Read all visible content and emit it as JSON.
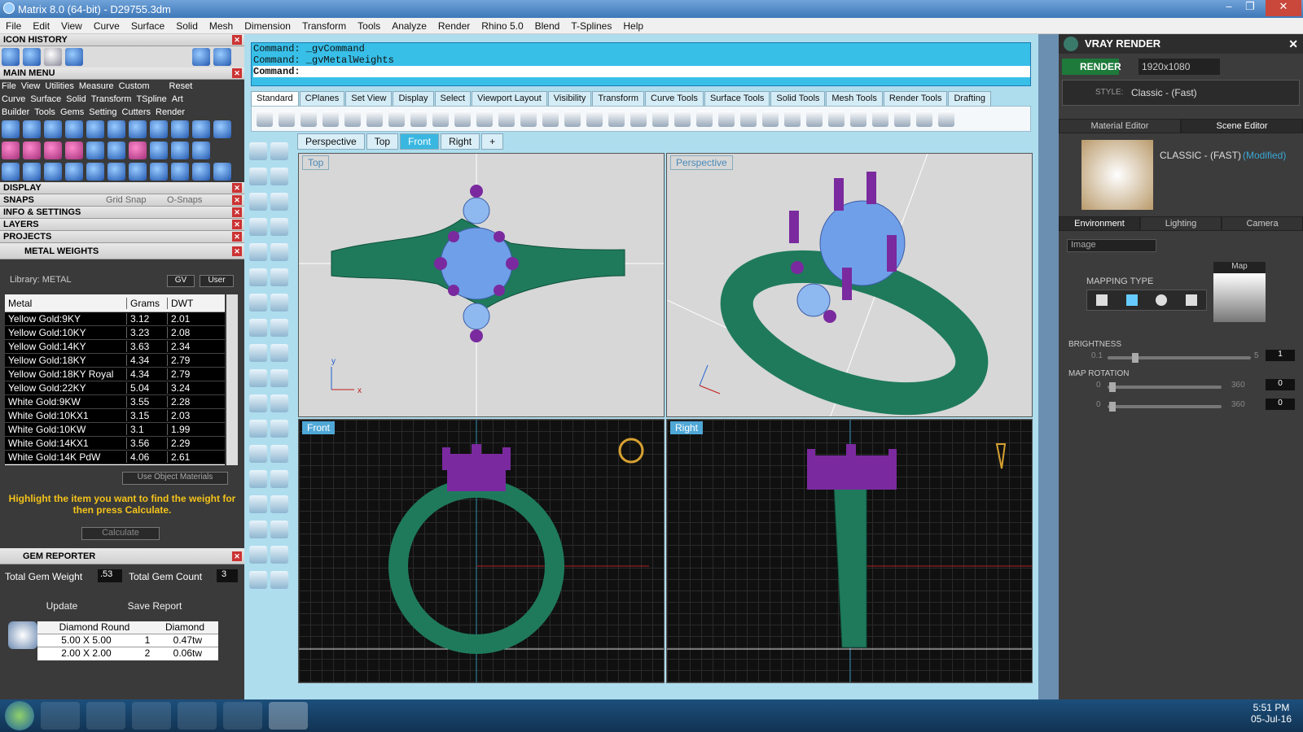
{
  "window": {
    "title": "Matrix 8.0 (64-bit) - D29755.3dm",
    "min": "–",
    "max": "❐",
    "close": "✕"
  },
  "menu": [
    "File",
    "Edit",
    "View",
    "Curve",
    "Surface",
    "Solid",
    "Mesh",
    "Dimension",
    "Transform",
    "Tools",
    "Analyze",
    "Render",
    "Rhino 5.0",
    "Blend",
    "T-Splines",
    "Help"
  ],
  "left": {
    "icon_history": "ICON HISTORY",
    "main_menu": "MAIN MENU",
    "main_sub": [
      "File",
      "View",
      "Utilities",
      "Measure",
      "Custom",
      "Reset"
    ],
    "tools_row1": [
      "Curve",
      "Surface",
      "Solid",
      "Transform",
      "TSpline",
      "Art"
    ],
    "tools_row2": [
      "Builder",
      "Tools",
      "Gems",
      "Setting",
      "Cutters",
      "Render"
    ],
    "display": "DISPLAY",
    "snaps": "SNAPS",
    "grid_snap": "Grid Snap",
    "o_snaps": "O-Snaps",
    "info": "INFO & SETTINGS",
    "layers": "LAYERS",
    "projects": "PROJECTS",
    "metal_weights": "METAL WEIGHTS",
    "library": "Library: METAL",
    "gv": "GV",
    "user": "User",
    "table_header": {
      "metal": "Metal",
      "grams": "Grams",
      "dwt": "DWT"
    },
    "metals": [
      [
        "Yellow Gold:9KY",
        "3.12",
        "2.01"
      ],
      [
        "Yellow Gold:10KY",
        "3.23",
        "2.08"
      ],
      [
        "Yellow Gold:14KY",
        "3.63",
        "2.34"
      ],
      [
        "Yellow Gold:18KY",
        "4.34",
        "2.79"
      ],
      [
        "Yellow Gold:18KY Royal",
        "4.34",
        "2.79"
      ],
      [
        "Yellow Gold:22KY",
        "5.04",
        "3.24"
      ],
      [
        "White Gold:9KW",
        "3.55",
        "2.28"
      ],
      [
        "White Gold:10KX1",
        "3.15",
        "2.03"
      ],
      [
        "White Gold:10KW",
        "3.1",
        "1.99"
      ],
      [
        "White Gold:14KX1",
        "3.56",
        "2.29"
      ],
      [
        "White Gold:14K PdW",
        "4.06",
        "2.61"
      ]
    ],
    "use_obj": "Use Object Materials",
    "hint": "Highlight the item you want to find the weight for then press Calculate.",
    "calculate": "Calculate",
    "gem_reporter": "GEM REPORTER",
    "total_gem_weight_label": "Total Gem Weight",
    "total_gem_weight": ".53",
    "total_gem_count_label": "Total Gem Count",
    "total_gem_count": "3",
    "update": "Update",
    "save_report": "Save Report",
    "gem_header": [
      "Diamond Round",
      "Diamond"
    ],
    "gems": [
      [
        "5.00 X 5.00",
        "1",
        "0.47tw"
      ],
      [
        "2.00 X 2.00",
        "2",
        "0.06tw"
      ]
    ]
  },
  "center": {
    "cmd1": "Command: _gvCommand",
    "cmd2": "Command: _gvMetalWeights",
    "cmd3": "Command:",
    "tabs": [
      "Standard",
      "CPlanes",
      "Set View",
      "Display",
      "Select",
      "Viewport Layout",
      "Visibility",
      "Transform",
      "Curve Tools",
      "Surface Tools",
      "Solid Tools",
      "Mesh Tools",
      "Render Tools",
      "Drafting"
    ],
    "view_tabs": [
      "Perspective",
      "Top",
      "Front",
      "Right"
    ],
    "vp_top": "Top",
    "vp_persp": "Perspective",
    "vp_front": "Front",
    "vp_right": "Right"
  },
  "right": {
    "title": "VRAY RENDER",
    "render": "RENDER",
    "resolution": "1920x1080",
    "style_label": "STYLE:",
    "style": "Classic - (Fast)",
    "mat_editor": "Material Editor",
    "scene_editor": "Scene Editor",
    "preset": "CLASSIC - (FAST)",
    "modified": "(Modified)",
    "env_tabs": [
      "Environment",
      "Lighting",
      "Camera"
    ],
    "image": "Image",
    "map": "Map",
    "mapping_type": "MAPPING TYPE",
    "brightness": "BRIGHTNESS",
    "b_min": "0.1",
    "b_max": "5",
    "b_val": "1",
    "map_rotation": "MAP ROTATION",
    "r1_min": "0",
    "r1_max": "360",
    "r1_val": "0",
    "r2_min": "0",
    "r2_max": "360",
    "r2_val": "0"
  },
  "taskbar": {
    "time": "5:51 PM",
    "date": "05-Jul-16"
  },
  "colors": {
    "ring": "#1e7a5a",
    "prong": "#7a2a9e",
    "gem": "#6f9fe8"
  }
}
